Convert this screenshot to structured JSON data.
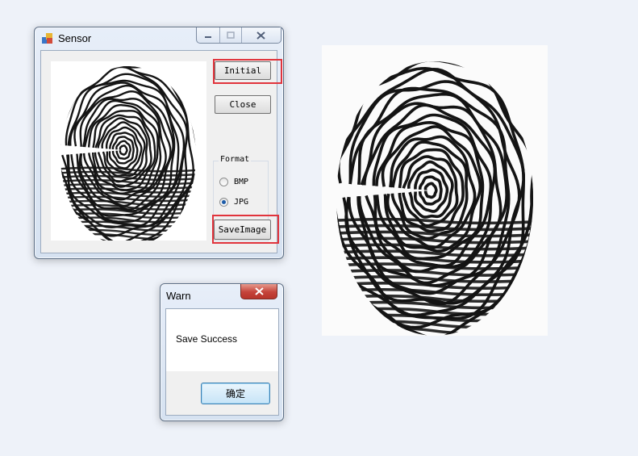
{
  "sensor_window": {
    "title": "Sensor",
    "buttons": {
      "initial": "Initial",
      "close": "Close",
      "save_image": "SaveImage"
    },
    "format_group": {
      "label": "Format",
      "options": [
        {
          "label": "BMP",
          "selected": false
        },
        {
          "label": "JPG",
          "selected": true
        }
      ]
    },
    "caption_icons": [
      "minimize-icon",
      "maximize-icon",
      "close-icon"
    ]
  },
  "warn_dialog": {
    "title": "Warn",
    "message": "Save Success",
    "ok_label": "确定"
  },
  "colors": {
    "highlight": "#e1343c",
    "background": "#eef2f9",
    "close_button": "#c4433a"
  }
}
